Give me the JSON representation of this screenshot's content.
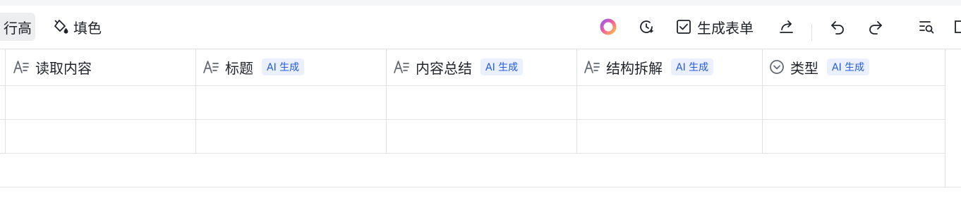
{
  "toolbar": {
    "row_height_label": "行高",
    "fill_label": "填色",
    "generate_form_label": "生成表单"
  },
  "icons": {
    "fill": "paint-bucket-icon",
    "ai_assistant": "ai-ring-icon",
    "history": "clock-history-icon",
    "form": "checkbox-form-icon",
    "share": "share-arrow-icon",
    "undo": "undo-icon",
    "redo": "redo-icon",
    "search": "list-search-icon",
    "more": "more-icon",
    "text_field": "text-field-icon",
    "select_field": "single-select-icon"
  },
  "columns": [
    {
      "label": "读取内容",
      "icon": "text-field-icon",
      "ai_badge": ""
    },
    {
      "label": "标题",
      "icon": "text-field-icon",
      "ai_badge": "AI 生成"
    },
    {
      "label": "内容总结",
      "icon": "text-field-icon",
      "ai_badge": "AI 生成"
    },
    {
      "label": "结构拆解",
      "icon": "text-field-icon",
      "ai_badge": "AI 生成"
    },
    {
      "label": "类型",
      "icon": "single-select-icon",
      "ai_badge": "AI 生成"
    }
  ],
  "rows": [
    [
      "",
      "",
      "",
      "",
      ""
    ],
    [
      "",
      "",
      "",
      "",
      ""
    ]
  ],
  "colors": {
    "accent": "#245bdb",
    "badge_bg": "#eaf0ff",
    "border": "#dee0e3",
    "text": "#1f2329",
    "icon": "#646a73"
  }
}
